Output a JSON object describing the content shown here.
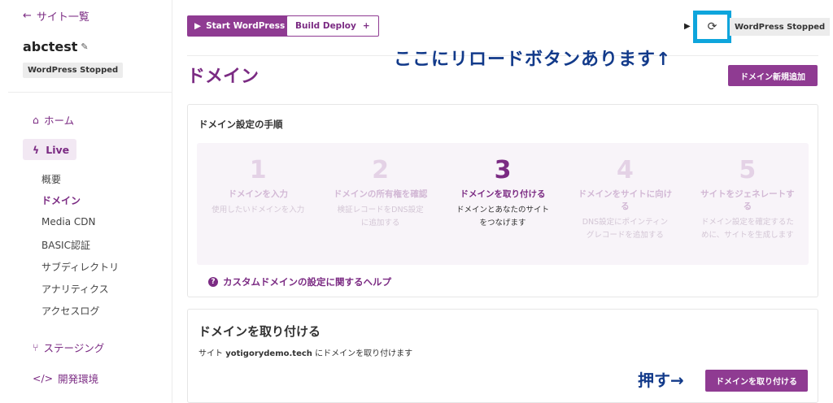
{
  "sidebar": {
    "back_label": "サイト一覧",
    "site_name": "abctest",
    "status": "WordPress Stopped",
    "home": "ホーム",
    "live": "Live",
    "sub_items": [
      "概要",
      "ドメイン",
      "Media CDN",
      "BASIC認証",
      "サブディレクトリ",
      "アナリティクス",
      "アクセスログ"
    ],
    "active_sub": "ドメイン",
    "staging": "ステージング",
    "dev": "開発環境"
  },
  "topbar": {
    "start_label": "Start WordPress",
    "build_label": "Build Deploy",
    "wp_status": "WordPress Stopped"
  },
  "annotations": {
    "reload_note": "ここにリロードボタンあります↑",
    "push_note": "押す→"
  },
  "page": {
    "title": "ドメイン",
    "add_domain_label": "ドメイン新規追加"
  },
  "steps": {
    "heading": "ドメイン設定の手順",
    "items": [
      {
        "num": "1",
        "title": "ドメインを入力",
        "desc": "使用したいドメインを入力"
      },
      {
        "num": "2",
        "title": "ドメインの所有権を確認",
        "desc": "検証レコードをDNS設定に追加する"
      },
      {
        "num": "3",
        "title": "ドメインを取り付ける",
        "desc": "ドメインとあなたのサイトをつなげます"
      },
      {
        "num": "4",
        "title": "ドメインをサイトに向ける",
        "desc": "DNS設定にポインティングレコードを追加する"
      },
      {
        "num": "5",
        "title": "サイトをジェネレートする",
        "desc": "ドメイン設定を確定するために、サイトを生成します"
      }
    ],
    "active_step": 3,
    "help_label": "カスタムドメインの設定に関するヘルプ"
  },
  "attach": {
    "title": "ドメインを取り付ける",
    "desc_prefix": "サイト",
    "site_domain": "yotigorydemo.tech",
    "desc_suffix": "にドメインを取り付けます",
    "button_label": "ドメインを取り付ける"
  },
  "colors": {
    "brand": "#8f3b92",
    "highlight": "#0ea5dc",
    "annotation": "#123a8a"
  }
}
